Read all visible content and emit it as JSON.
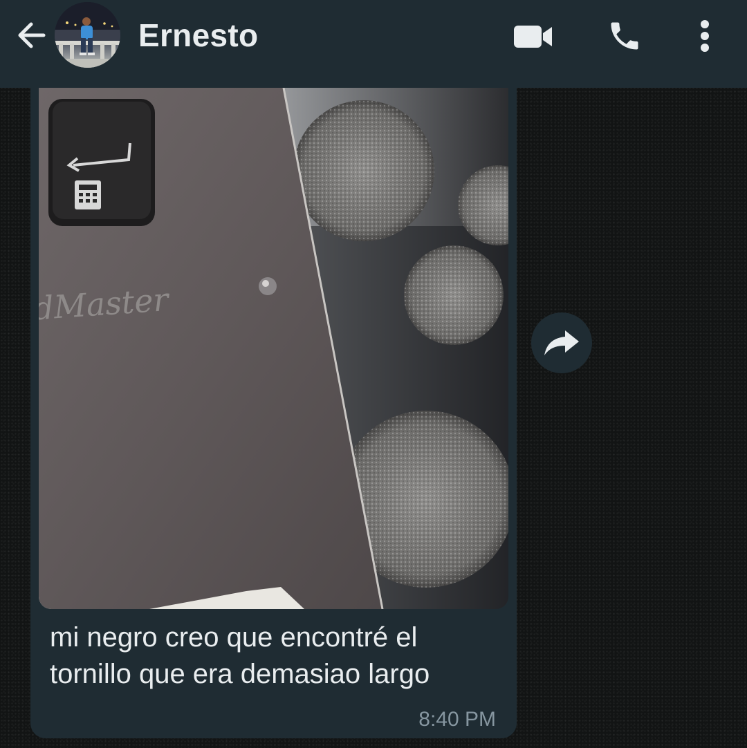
{
  "header": {
    "contact_name": "Ernesto"
  },
  "message": {
    "image_text": "idMaster",
    "caption": "mi negro creo que encontré el tornillo que era demasiao largo",
    "time": "8:40 PM"
  },
  "colors": {
    "header_bg": "#1f2c33",
    "bubble_bg": "#1f2c33",
    "primary_text": "#e9edef",
    "secondary_text": "#8696a0"
  },
  "icons": {
    "back": "arrow-left-icon",
    "video": "video-camera-icon",
    "call": "phone-icon",
    "menu": "more-vertical-icon",
    "forward": "forward-arrow-icon"
  }
}
